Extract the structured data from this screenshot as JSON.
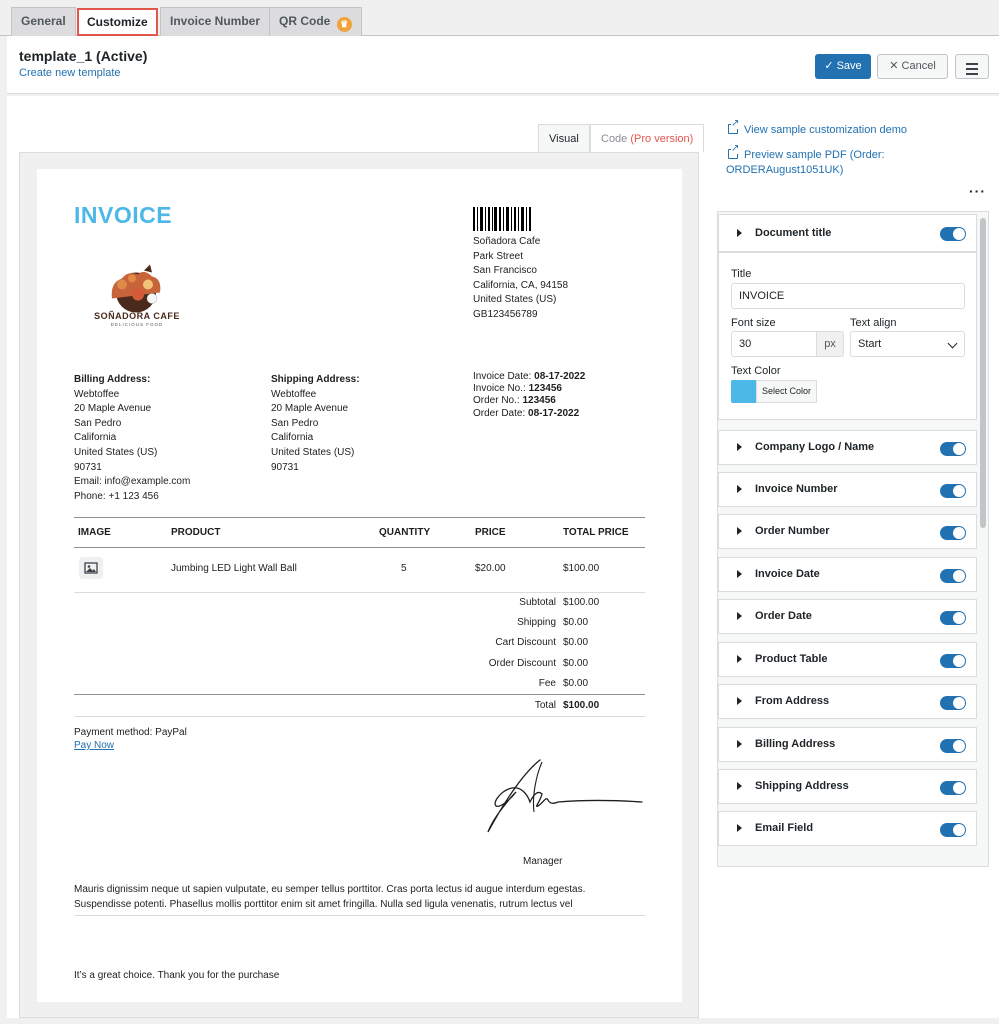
{
  "tabs": [
    {
      "label": "General"
    },
    {
      "label": "Customize",
      "active": true
    },
    {
      "label": "Invoice Number"
    },
    {
      "label": "QR Code",
      "crown": "crown-icon"
    }
  ],
  "header": {
    "template_title": "template_1 (Active)",
    "create_link": "Create new template",
    "save_label": "Save",
    "cancel_label": "Cancel"
  },
  "preview_tabs": {
    "visual": "Visual",
    "code": "Code",
    "code_pro": "(Pro version)"
  },
  "invoice": {
    "title": "INVOICE",
    "logo_name": "SOÑADORA CAFE",
    "logo_sub": "DELICIOUS FOOD",
    "from": [
      "Soñadora Cafe",
      "Park Street",
      "San Francisco",
      "California, CA, 94158",
      "United States (US)",
      "GB123456789"
    ],
    "billing_title": "Billing Address:",
    "billing": [
      "Webtoffee",
      "20 Maple Avenue",
      "San Pedro",
      "California",
      "United States (US)",
      "90731",
      "Email: info@example.com",
      "Phone: +1 123 456"
    ],
    "shipping_title": "Shipping Address:",
    "shipping": [
      "Webtoffee",
      "20 Maple Avenue",
      "San Pedro",
      "California",
      "United States (US)",
      "90731"
    ],
    "meta": [
      {
        "label": "Invoice Date:",
        "value": "08-17-2022"
      },
      {
        "label": "Invoice No.:",
        "value": "123456"
      },
      {
        "label": "Order No.:",
        "value": "123456"
      },
      {
        "label": "Order Date:",
        "value": "08-17-2022"
      }
    ],
    "table_headers": [
      "IMAGE",
      "PRODUCT",
      "QUANTITY",
      "PRICE",
      "TOTAL PRICE"
    ],
    "row": {
      "product": "Jumbing LED Light Wall Ball",
      "quantity": "5",
      "price": "$20.00",
      "total": "$100.00"
    },
    "totals": [
      {
        "label": "Subtotal",
        "value": "$100.00"
      },
      {
        "label": "Shipping",
        "value": "$0.00"
      },
      {
        "label": "Cart Discount",
        "value": "$0.00"
      },
      {
        "label": "Order Discount",
        "value": "$0.00"
      },
      {
        "label": "Fee",
        "value": "$0.00"
      }
    ],
    "grand_total": {
      "label": "Total",
      "value": "$100.00"
    },
    "payment_method": "Payment method: PayPal",
    "pay_now": "Pay Now",
    "signatory": "Manager",
    "footer": "Mauris dignissim neque ut sapien vulputate, eu semper tellus porttitor. Cras porta lectus id augue interdum egestas. Suspendisse potenti. Phasellus mollis porttitor enim sit amet fringilla. Nulla sed ligula venenatis, rutrum lectus vel",
    "thanks": "It’s a great choice. Thank you for the purchase"
  },
  "sidebar": {
    "demo_link": "View sample customization demo",
    "pdf_link_1": "Preview sample PDF (Order:",
    "pdf_link_2": "ORDERAugust1051UK)",
    "doc_title_section": "Document title",
    "title_label": "Title",
    "title_value": "INVOICE",
    "font_size_label": "Font size",
    "font_size_value": "30",
    "font_size_unit": "px",
    "text_align_label": "Text align",
    "text_align_value": "Start",
    "text_color_label": "Text Color",
    "select_color": "Select Color",
    "text_color_hex": "#4cb8e8",
    "sections": [
      "Company Logo / Name",
      "Invoice Number",
      "Order Number",
      "Invoice Date",
      "Order Date",
      "Product Table",
      "From Address",
      "Billing Address",
      "Shipping Address",
      "Email Field"
    ]
  }
}
